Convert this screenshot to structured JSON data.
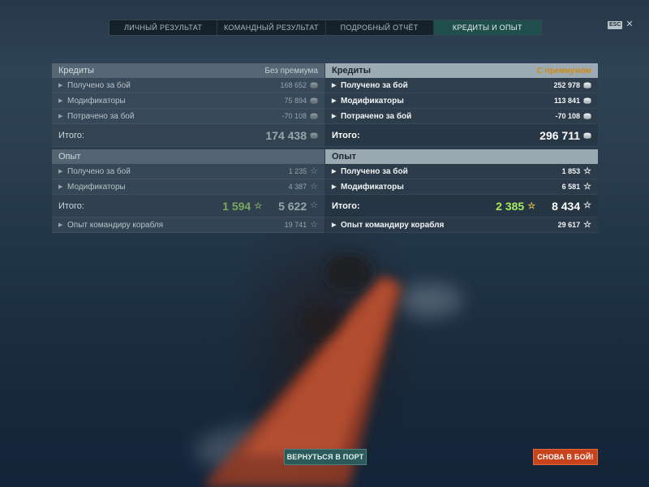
{
  "tabs": [
    {
      "label": "ЛИЧНЫЙ РЕЗУЛЬТАТ"
    },
    {
      "label": "КОМАНДНЫЙ РЕЗУЛЬТАТ"
    },
    {
      "label": "ПОДРОБНЫЙ ОТЧЁТ"
    },
    {
      "label": "КРЕДИТЫ И ОПЫТ"
    }
  ],
  "active_tab": "КРЕДИТЫ И ОПЫТ",
  "esc": {
    "badge": "ESC",
    "close": "✕"
  },
  "standard": {
    "credits": {
      "title": "Кредиты",
      "note": "Без премиума",
      "rows": [
        {
          "label": "Получено за бой",
          "value": "168 652"
        },
        {
          "label": "Модификаторы",
          "value": "75 894"
        },
        {
          "label": "Потрачено за бой",
          "value": "-70 108"
        }
      ],
      "total_label": "Итого:",
      "total_value": "174 438"
    },
    "xp": {
      "title": "Опыт",
      "rows": [
        {
          "label": "Получено за бой",
          "value": "1 235"
        },
        {
          "label": "Модификаторы",
          "value": "4 387"
        }
      ],
      "total_label": "Итого:",
      "total_green": "1 594",
      "total_value": "5 622",
      "commander_label": "Опыт командиру корабля",
      "commander_value": "19 741"
    }
  },
  "premium": {
    "credits": {
      "title": "Кредиты",
      "note": "С премиумом",
      "rows": [
        {
          "label": "Получено за бой",
          "value": "252 978"
        },
        {
          "label": "Модификаторы",
          "value": "113 841"
        },
        {
          "label": "Потрачено за бой",
          "value": "-70 108"
        }
      ],
      "total_label": "Итого:",
      "total_value": "296 711"
    },
    "xp": {
      "title": "Опыт",
      "rows": [
        {
          "label": "Получено за бой",
          "value": "1 853"
        },
        {
          "label": "Модификаторы",
          "value": "6 581"
        }
      ],
      "total_label": "Итого:",
      "total_green": "2 385",
      "total_value": "8 434",
      "commander_label": "Опыт командиру корабля",
      "commander_value": "29 617"
    }
  },
  "buttons": {
    "port": "ВЕРНУТЬСЯ В ПОРТ",
    "fight": "СНОВА В БОЙ!"
  },
  "icons": {
    "credit": "credit-coin-icon",
    "xp": "star-icon",
    "row": "triangle-right-icon"
  },
  "colors": {
    "active_tab": "#1f4e4c",
    "premium_note": "#d08a12",
    "xp_green": "#a8e860",
    "fight_button": "#c8431c",
    "port_button": "#2c5a5a"
  }
}
